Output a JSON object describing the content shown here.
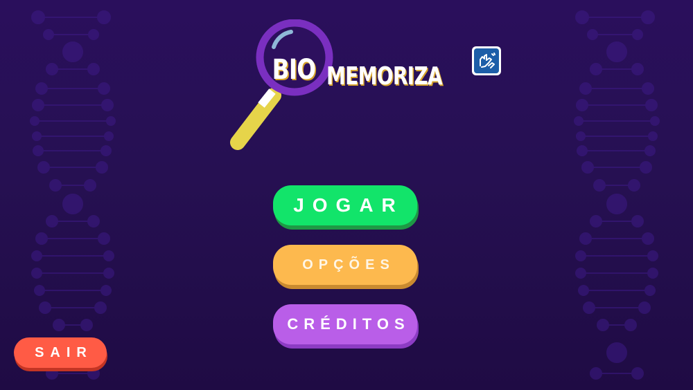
{
  "logo": {
    "bio": "BIO",
    "memoriza": "MEMORIZA"
  },
  "accessibility": {
    "icon": "sign-language-icon"
  },
  "menu": {
    "play_label": "JOGAR",
    "options_label": "OPÇÕES",
    "credits_label": "CRÉDITOS",
    "exit_label": "SAIR"
  },
  "colors": {
    "background": "#261052",
    "play": "#12e46a",
    "options": "#fdb94e",
    "credits": "#b95ee8",
    "exit": "#ff5b45",
    "magnifier_ring": "#7a2fc0",
    "magnifier_handle": "#e6d44a"
  }
}
